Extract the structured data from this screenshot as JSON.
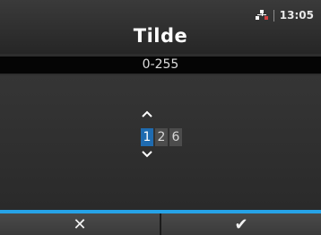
{
  "status": {
    "time": "13:05",
    "network_icon": "network-icon",
    "network_dot_color": "#d24040"
  },
  "title": "Tilde",
  "range": "0-255",
  "value": {
    "digits": [
      "1",
      "2",
      "6"
    ],
    "selected_index": 0
  },
  "controls": {
    "up_icon": "chevron-up-icon",
    "down_icon": "chevron-down-icon"
  },
  "footer": {
    "cancel_glyph": "✕",
    "confirm_glyph": "✔",
    "accent_color": "#26a3e8"
  },
  "colors": {
    "selected_digit": "#1f6bb0",
    "digit_bg": "#4c4c4c"
  }
}
